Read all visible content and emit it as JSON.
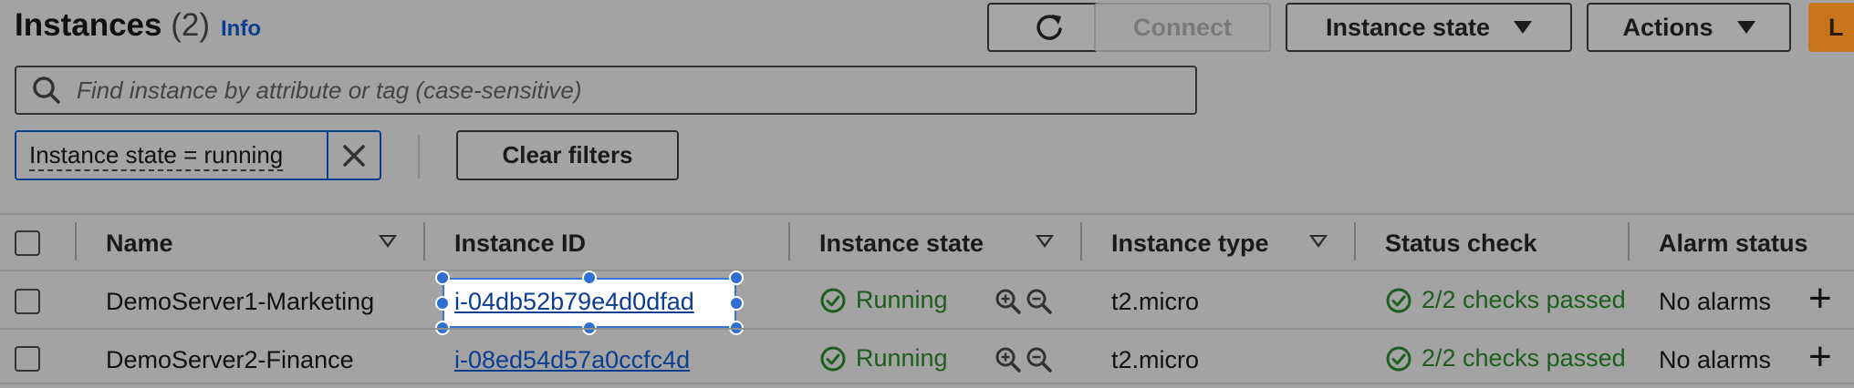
{
  "header": {
    "title": "Instances",
    "count": "(2)",
    "info_label": "Info"
  },
  "toolbar": {
    "refresh_icon": "refresh-icon",
    "connect_label": "Connect",
    "instance_state_label": "Instance state",
    "actions_label": "Actions",
    "launch_label": "L"
  },
  "search": {
    "placeholder": "Find instance by attribute or tag (case-sensitive)"
  },
  "filter": {
    "chip_label": "Instance state = running",
    "clear_label": "Clear filters"
  },
  "table": {
    "columns": [
      "Name",
      "Instance ID",
      "Instance state",
      "Instance type",
      "Status check",
      "Alarm status"
    ],
    "rows": [
      {
        "name": "DemoServer1-Marketing",
        "instance_id": "i-04db52b79e4d0dfad",
        "state": "Running",
        "type": "t2.micro",
        "status_check": "2/2 checks passed",
        "alarm": "No alarms",
        "selected": true
      },
      {
        "name": "DemoServer2-Finance",
        "instance_id": "i-08ed54d57a0ccfc4d",
        "state": "Running",
        "type": "t2.micro",
        "status_check": "2/2 checks passed",
        "alarm": "No alarms",
        "selected": false
      }
    ]
  },
  "colors": {
    "link": "#0b3d91",
    "success": "#1d5e1d",
    "launch": "#c8741c",
    "selection": "#2f6fcf"
  }
}
